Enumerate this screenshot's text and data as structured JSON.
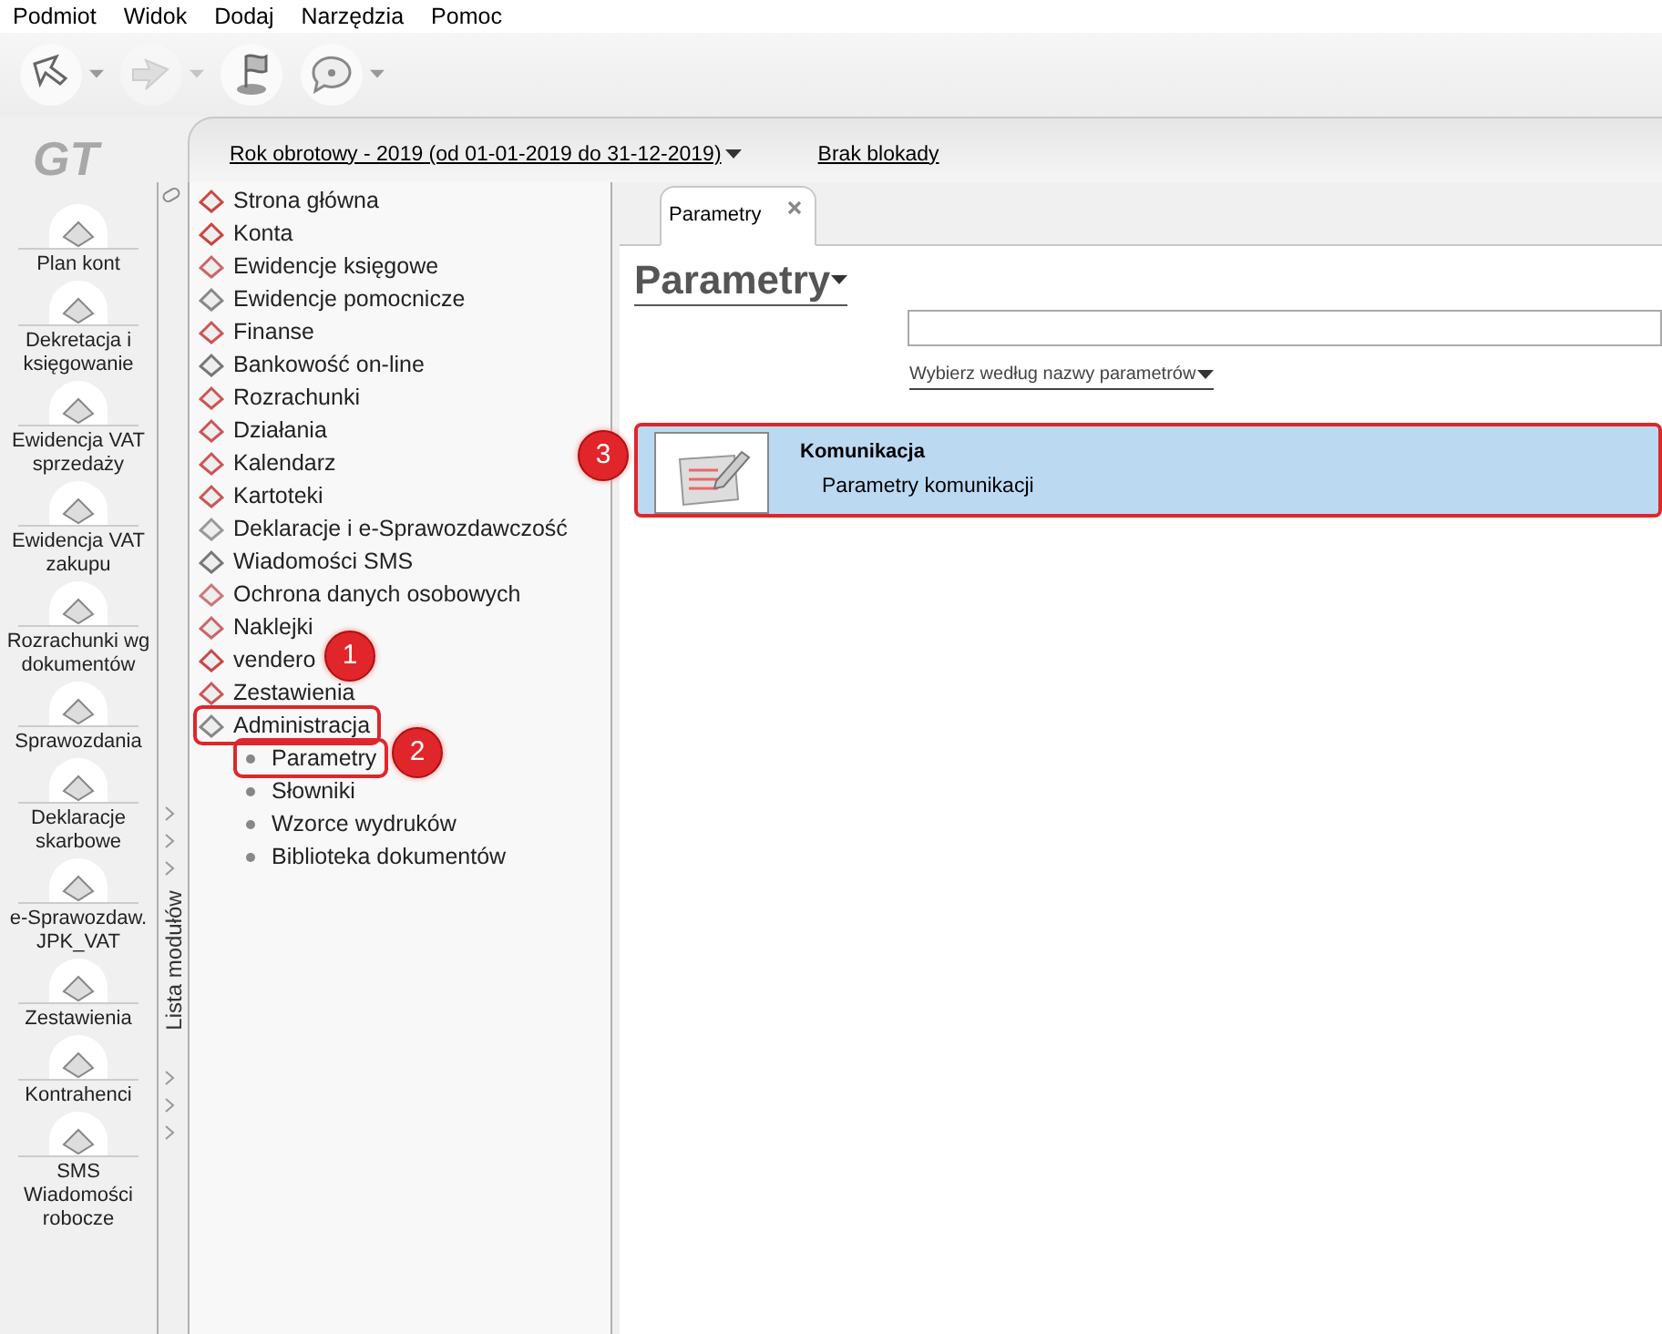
{
  "menu": [
    "Podmiot",
    "Widok",
    "Dodaj",
    "Narzędzia",
    "Pomoc"
  ],
  "toolbar": [
    {
      "kind": "back",
      "dropdown": true,
      "disabled": false
    },
    {
      "kind": "forward",
      "dropdown": true,
      "disabled": true
    },
    {
      "kind": "flag",
      "dropdown": false,
      "disabled": false
    },
    {
      "kind": "help",
      "dropdown": true,
      "disabled": false
    }
  ],
  "logo": "GT",
  "modules": [
    "Plan kont",
    "Dekretacja i\nksięgowanie",
    "Ewidencja VAT\nsprzedaży",
    "Ewidencja VAT\nzakupu",
    "Rozrachunki wg\ndokumentów",
    "Sprawozdania",
    "Deklaracje\nskarbowe",
    "e-Sprawozdaw.\nJPK_VAT",
    "Zestawienia",
    "Kontrahenci",
    "SMS\nWiadomości\nrobocze"
  ],
  "fiscal_year": "Rok obrotowy - 2019  (od 01-01-2019 do 31-12-2019)",
  "lock_status": "Brak blokady",
  "module_strip_label": "Lista modułów",
  "tree": [
    {
      "label": "Strona główna",
      "highlighted": false
    },
    {
      "label": "Konta",
      "highlighted": false
    },
    {
      "label": "Ewidencje księgowe",
      "highlighted": false
    },
    {
      "label": "Ewidencje pomocnicze",
      "highlighted": false
    },
    {
      "label": "Finanse",
      "highlighted": false
    },
    {
      "label": "Bankowość on-line",
      "highlighted": false
    },
    {
      "label": "Rozrachunki",
      "highlighted": false
    },
    {
      "label": "Działania",
      "highlighted": false
    },
    {
      "label": "Kalendarz",
      "highlighted": false
    },
    {
      "label": "Kartoteki",
      "highlighted": false
    },
    {
      "label": "Deklaracje i e-Sprawozdawczość",
      "highlighted": false
    },
    {
      "label": "Wiadomości SMS",
      "highlighted": false
    },
    {
      "label": "Ochrona danych osobowych",
      "highlighted": false
    },
    {
      "label": "Naklejki",
      "highlighted": false
    },
    {
      "label": "vendero",
      "highlighted": false
    },
    {
      "label": "Zestawienia",
      "highlighted": false
    },
    {
      "label": "Administracja",
      "highlighted": true,
      "expanded": true,
      "children": [
        {
          "label": "Parametry",
          "highlighted": true
        },
        {
          "label": "Słowniki",
          "highlighted": false
        },
        {
          "label": "Wzorce wydruków",
          "highlighted": false
        },
        {
          "label": "Biblioteka dokumentów",
          "highlighted": false
        }
      ]
    }
  ],
  "tabs": [
    {
      "label": "Parametry",
      "selected": true
    }
  ],
  "heading": "Parametry",
  "filter": "Wybierz według nazwy parametrów",
  "items": [
    {
      "title": "Komunikacja",
      "description": "Parametry komunikacji",
      "selected": true,
      "highlighted": true
    }
  ],
  "annotations": [
    "1",
    "2",
    "3"
  ]
}
